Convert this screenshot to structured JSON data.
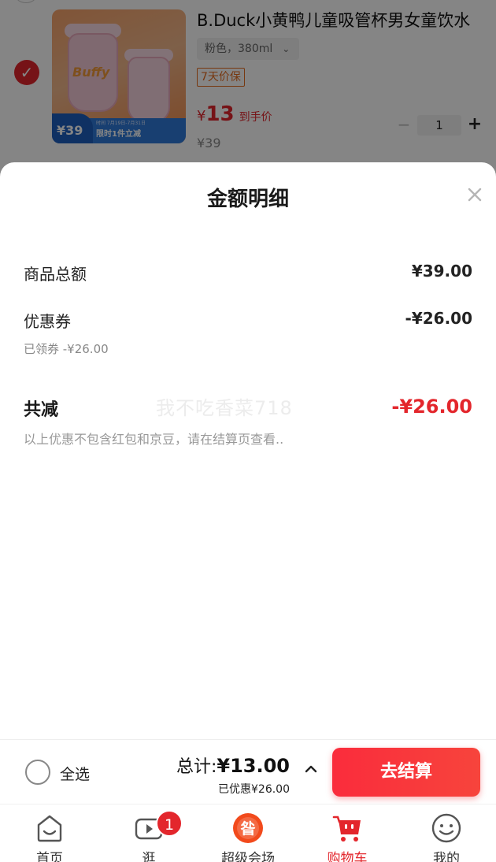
{
  "product": {
    "title": "B.Duck小黄鸭儿童吸管杯男女童饮水",
    "spec": "粉色，380ml",
    "spec_arrow": "⌄",
    "tag": "7天价保",
    "price_symbol": "¥",
    "price_value": "13",
    "price_label": "到手价",
    "original_price": "¥39",
    "quantity": "1",
    "minus_label": "−",
    "plus_label": "+",
    "image_brand": "Buffy",
    "image_price": "39",
    "image_promo": "限时1件立减",
    "image_dates": "时间 7月19日-7月31日"
  },
  "sheet": {
    "title": "金额明细",
    "rows": {
      "goods_total": {
        "label": "商品总额",
        "value": "¥39.00"
      },
      "coupon": {
        "label": "优惠券",
        "value": "-¥26.00",
        "sub": "已领券 -¥26.00"
      },
      "total_discount": {
        "label": "共减",
        "value": "-¥26.00"
      }
    },
    "note": "以上优惠不包含红包和京豆，请在结算页查看..",
    "watermark": "我不吃香菜718"
  },
  "checkout": {
    "select_all": "全选",
    "total_label": "总计:",
    "total_amount": "¥13.00",
    "discount_line": "已优惠¥26.00",
    "pay_button": "去结算"
  },
  "tabbar": {
    "items": [
      {
        "label": "首页",
        "icon": "home-icon"
      },
      {
        "label": "逛",
        "icon": "video-icon",
        "badge": "1"
      },
      {
        "label": "超级会场",
        "icon": "super-venue-icon"
      },
      {
        "label": "购物车",
        "icon": "cart-icon",
        "active": true
      },
      {
        "label": "我的",
        "icon": "profile-icon"
      }
    ]
  },
  "colors": {
    "accent": "#e3262c",
    "pay_button": "#fa2c3c",
    "overlay": "rgba(0,0,0,0.48)"
  }
}
